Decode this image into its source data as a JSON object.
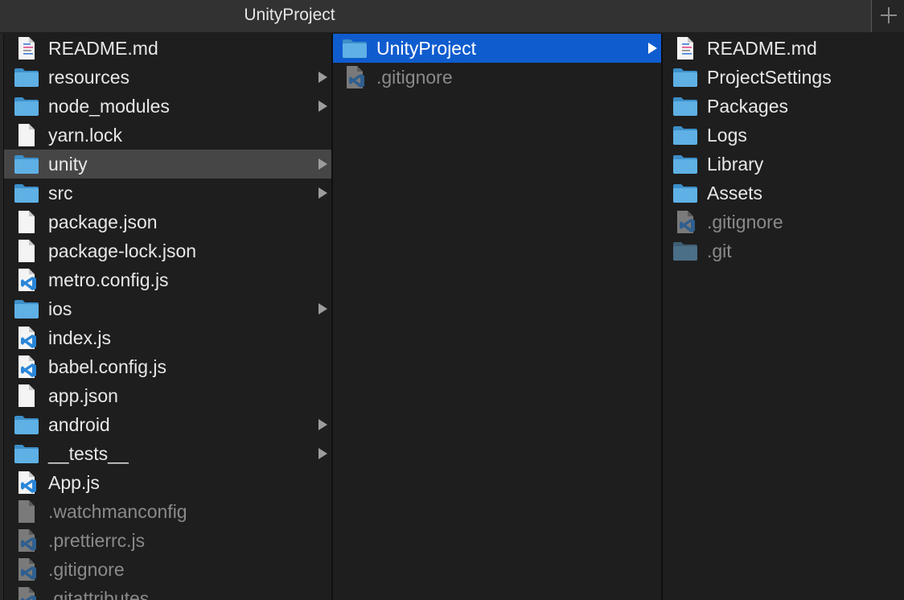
{
  "tab": {
    "title": "UnityProject",
    "add_label": ""
  },
  "columns": [
    {
      "items": [
        {
          "name": "README.md",
          "kind": "md",
          "dim": false,
          "chevron": false,
          "selected": ""
        },
        {
          "name": "resources",
          "kind": "folder",
          "dim": false,
          "chevron": true,
          "selected": ""
        },
        {
          "name": "node_modules",
          "kind": "folder",
          "dim": false,
          "chevron": true,
          "selected": ""
        },
        {
          "name": "yarn.lock",
          "kind": "file",
          "dim": false,
          "chevron": false,
          "selected": ""
        },
        {
          "name": "unity",
          "kind": "folder",
          "dim": false,
          "chevron": true,
          "selected": "gray"
        },
        {
          "name": "src",
          "kind": "folder",
          "dim": false,
          "chevron": true,
          "selected": ""
        },
        {
          "name": "package.json",
          "kind": "file",
          "dim": false,
          "chevron": false,
          "selected": ""
        },
        {
          "name": "package-lock.json",
          "kind": "file",
          "dim": false,
          "chevron": false,
          "selected": ""
        },
        {
          "name": "metro.config.js",
          "kind": "vscode",
          "dim": false,
          "chevron": false,
          "selected": ""
        },
        {
          "name": "ios",
          "kind": "folder",
          "dim": false,
          "chevron": true,
          "selected": ""
        },
        {
          "name": "index.js",
          "kind": "vscode",
          "dim": false,
          "chevron": false,
          "selected": ""
        },
        {
          "name": "babel.config.js",
          "kind": "vscode",
          "dim": false,
          "chevron": false,
          "selected": ""
        },
        {
          "name": "app.json",
          "kind": "file",
          "dim": false,
          "chevron": false,
          "selected": ""
        },
        {
          "name": "android",
          "kind": "folder",
          "dim": false,
          "chevron": true,
          "selected": ""
        },
        {
          "name": "__tests__",
          "kind": "folder",
          "dim": false,
          "chevron": true,
          "selected": ""
        },
        {
          "name": "App.js",
          "kind": "vscode",
          "dim": false,
          "chevron": false,
          "selected": ""
        },
        {
          "name": ".watchmanconfig",
          "kind": "file",
          "dim": true,
          "chevron": false,
          "selected": ""
        },
        {
          "name": ".prettierrc.js",
          "kind": "vscode",
          "dim": true,
          "chevron": false,
          "selected": ""
        },
        {
          "name": ".gitignore",
          "kind": "vscode",
          "dim": true,
          "chevron": false,
          "selected": ""
        },
        {
          "name": ".gitattributes",
          "kind": "vscode",
          "dim": true,
          "chevron": false,
          "selected": ""
        }
      ]
    },
    {
      "items": [
        {
          "name": "UnityProject",
          "kind": "folder",
          "dim": false,
          "chevron": true,
          "selected": "blue"
        },
        {
          "name": ".gitignore",
          "kind": "vscode",
          "dim": true,
          "chevron": false,
          "selected": ""
        }
      ]
    },
    {
      "items": [
        {
          "name": "README.md",
          "kind": "md",
          "dim": false,
          "chevron": false,
          "selected": ""
        },
        {
          "name": "ProjectSettings",
          "kind": "folder",
          "dim": false,
          "chevron": false,
          "selected": ""
        },
        {
          "name": "Packages",
          "kind": "folder",
          "dim": false,
          "chevron": false,
          "selected": ""
        },
        {
          "name": "Logs",
          "kind": "folder",
          "dim": false,
          "chevron": false,
          "selected": ""
        },
        {
          "name": "Library",
          "kind": "folder",
          "dim": false,
          "chevron": false,
          "selected": ""
        },
        {
          "name": "Assets",
          "kind": "folder",
          "dim": false,
          "chevron": false,
          "selected": ""
        },
        {
          "name": ".gitignore",
          "kind": "vscode",
          "dim": true,
          "chevron": false,
          "selected": ""
        },
        {
          "name": ".git",
          "kind": "folder",
          "dim": true,
          "chevron": false,
          "selected": ""
        }
      ]
    }
  ],
  "colors": {
    "folder": "#5fb0e4",
    "folder_dark": "#3c8fc9",
    "folder_dim": "#4b6f87",
    "selection_blue": "#0f5ccf",
    "selection_gray": "#464646",
    "vscode_blue": "#2a86d8"
  }
}
